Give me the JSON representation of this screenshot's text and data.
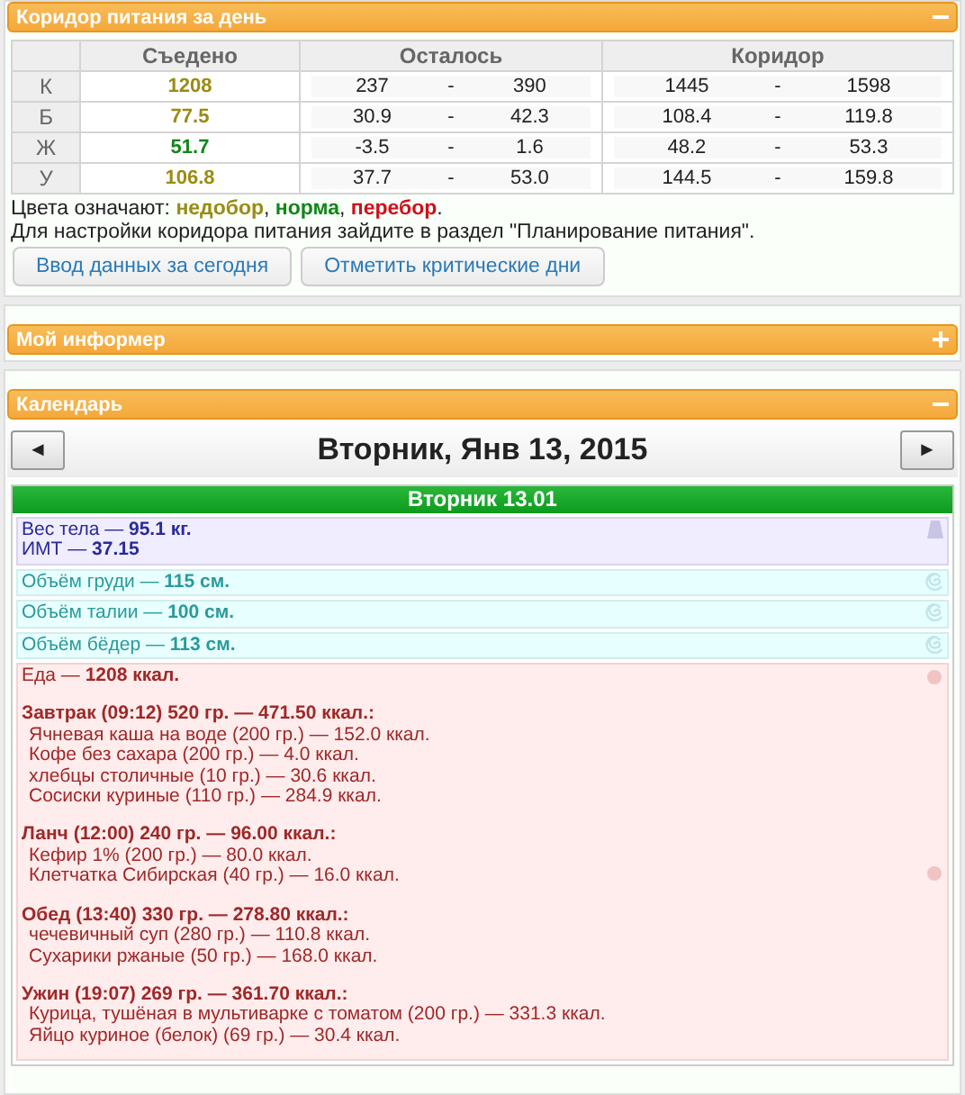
{
  "corridor_panel": {
    "title": "Коридор питания за день",
    "expanded": true,
    "columns": [
      "Съедено",
      "Осталось",
      "Коридор"
    ],
    "rows": [
      {
        "label": "К",
        "eaten": "1208",
        "color": "#9a8c12",
        "remaining": {
          "from": "237",
          "sep": "-",
          "to": "390"
        },
        "corridor": {
          "from": "1445",
          "sep": "-",
          "to": "1598"
        }
      },
      {
        "label": "Б",
        "eaten": "77.5",
        "color": "#9a8c12",
        "remaining": {
          "from": "30.9",
          "sep": "-",
          "to": "42.3"
        },
        "corridor": {
          "from": "108.4",
          "sep": "-",
          "to": "119.8"
        }
      },
      {
        "label": "Ж",
        "eaten": "51.7",
        "color": "#12861a",
        "remaining": {
          "from": "-3.5",
          "sep": "-",
          "to": "1.6"
        },
        "corridor": {
          "from": "48.2",
          "sep": "-",
          "to": "53.3"
        }
      },
      {
        "label": "У",
        "eaten": "106.8",
        "color": "#9a8c12",
        "remaining": {
          "from": "37.7",
          "sep": "-",
          "to": "53.0"
        },
        "corridor": {
          "from": "144.5",
          "sep": "-",
          "to": "159.8"
        }
      }
    ],
    "legend": {
      "prefix": "Цвета означают: ",
      "items": [
        {
          "text": "недобор",
          "color": "#9a8c12"
        },
        {
          "text": "норма",
          "color": "#12861a"
        },
        {
          "text": "перебор",
          "color": "#d0101a"
        }
      ],
      "separator": ", ",
      "end": "."
    },
    "note": "Для настройки коридора питания зайдите в раздел \"Планирование питания\".",
    "buttons": [
      "Ввод данных за сегодня",
      "Отметить критические дни"
    ]
  },
  "informer_panel": {
    "title": "Мой информер",
    "expanded": false
  },
  "calendar_panel": {
    "title": "Календарь",
    "expanded": true,
    "date": "Вторник, Янв 13, 2015",
    "prev": "◄",
    "next": "►",
    "day_title": "Вторник 13.01",
    "entries": [
      {
        "kind": "weight",
        "lines": [
          "Вес тела — **95.1 кг.**",
          "ИМТ — **37.15**"
        ]
      },
      {
        "kind": "measure",
        "lines": [
          "Объём груди — **115 см.**"
        ]
      },
      {
        "kind": "measure",
        "lines": [
          "Объём талии — **100 см.**"
        ]
      },
      {
        "kind": "measure",
        "lines": [
          "Объём бёдер — **113 см.**"
        ]
      },
      {
        "kind": "food",
        "lines": [
          "Еда — **1208 ккал.**"
        ],
        "meals": [
          {
            "title": "Завтрак (09:12) 520 гр. — 471.50 ккал.:",
            "items": [
              "Ячневая каша на воде (200 гр.) — 152.0 ккал.",
              "Кофе без сахара (200 гр.) — 4.0 ккал.",
              "хлебцы столичные (10 гр.) — 30.6 ккал.",
              "Сосиски куриные (110 гр.) — 284.9 ккал."
            ]
          },
          {
            "title": "Ланч (12:00) 240 гр. — 96.00 ккал.:",
            "items": [
              "Кефир 1% (200 гр.) — 80.0 ккал.",
              "Клетчатка Сибирская (40 гр.) — 16.0 ккал."
            ]
          },
          {
            "title": "Обед (13:40) 330 гр. — 278.80 ккал.:",
            "items": [
              "чечевичный суп (280 гр.) — 110.8 ккал.",
              "Сухарики ржаные (50 гр.) — 168.0 ккал."
            ]
          },
          {
            "title": "Ужин (19:07) 269 гр. — 361.70 ккал.:",
            "items": [
              "Курица, тушёная в мультиварке с томатом (200 гр.) — 331.3 ккал.",
              "Яйцо куриное (белок) (69 гр.) — 30.4 ккал."
            ]
          }
        ]
      }
    ]
  }
}
